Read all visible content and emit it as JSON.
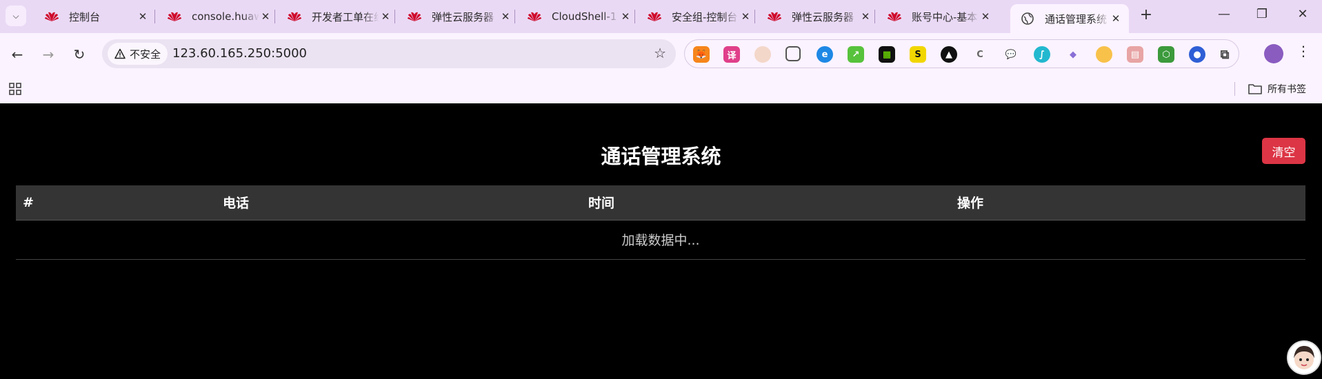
{
  "browser": {
    "tabs": [
      {
        "title": "控制台",
        "favicon": "huawei-icon",
        "active": false
      },
      {
        "title": "console.huaweicloud.com",
        "favicon": "huawei-icon",
        "active": false
      },
      {
        "title": "开发者工单在线",
        "favicon": "huawei-icon",
        "active": false
      },
      {
        "title": "弹性云服务器",
        "favicon": "huawei-icon",
        "active": false
      },
      {
        "title": "CloudShell-1",
        "favicon": "huawei-icon",
        "active": false
      },
      {
        "title": "安全组-控制台",
        "favicon": "huawei-icon",
        "active": false
      },
      {
        "title": "弹性云服务器",
        "favicon": "huawei-icon",
        "active": false
      },
      {
        "title": "账号中心-基本",
        "favicon": "huawei-icon",
        "active": false
      },
      {
        "title": "通话管理系统",
        "favicon": "globe-icon",
        "active": true
      }
    ],
    "security_label": "不安全",
    "url": "123.60.165.250:5000",
    "bookmarks_label": "所有书签"
  },
  "page": {
    "title": "通话管理系统",
    "clear_button": "清空",
    "table": {
      "headers": [
        "#",
        "电话",
        "时间",
        "操作"
      ],
      "loading_text": "加载数据中..."
    }
  },
  "colors": {
    "tabstrip": "#ead9f5",
    "toolbar": "#fbf3ff",
    "page_bg": "#000000",
    "table_header": "#343434",
    "danger": "#dc3545",
    "huawei_red": "#cf0a2c"
  }
}
